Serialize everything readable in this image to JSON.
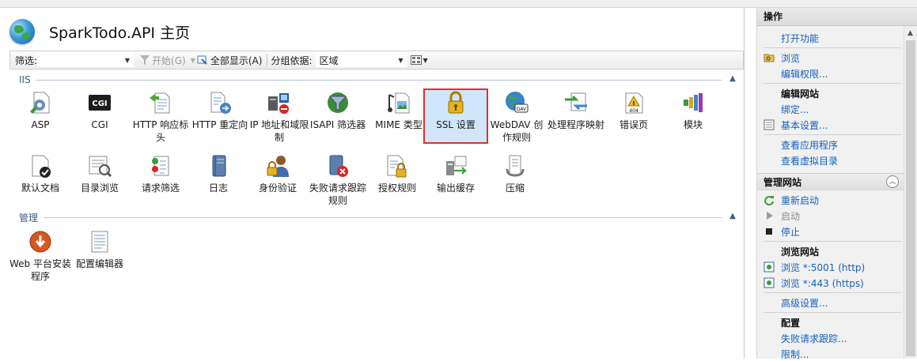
{
  "page": {
    "title": "SparkTodo.API 主页"
  },
  "toolbar": {
    "filter_label": "筛选:",
    "filter_value": "",
    "start_label": "开始(G)",
    "show_all_label": "全部显示(A)",
    "group_by_label": "分组依据:",
    "group_by_value": "区域"
  },
  "sections": {
    "iis": {
      "label": "IIS"
    },
    "management": {
      "label": "管理"
    }
  },
  "iis_items": [
    {
      "label": "ASP",
      "icon": "asp-icon"
    },
    {
      "label": "CGI",
      "icon": "cgi-icon"
    },
    {
      "label": "HTTP 响应标头",
      "icon": "http-response-headers-icon"
    },
    {
      "label": "HTTP 重定向",
      "icon": "http-redirect-icon"
    },
    {
      "label": "IP 地址和域限制",
      "icon": "ip-domain-restrictions-icon"
    },
    {
      "label": "ISAPI 筛选器",
      "icon": "isapi-filters-icon"
    },
    {
      "label": "MIME 类型",
      "icon": "mime-types-icon"
    },
    {
      "label": "SSL 设置",
      "icon": "ssl-lock-icon",
      "selected": true
    },
    {
      "label": "WebDAV 创作规则",
      "icon": "webdav-icon"
    },
    {
      "label": "处理程序映射",
      "icon": "handler-mappings-icon"
    },
    {
      "label": "错误页",
      "icon": "error-pages-icon"
    },
    {
      "label": "模块",
      "icon": "modules-icon"
    },
    {
      "label": "默认文档",
      "icon": "default-document-icon"
    },
    {
      "label": "目录浏览",
      "icon": "directory-browsing-icon"
    },
    {
      "label": "请求筛选",
      "icon": "request-filtering-icon"
    },
    {
      "label": "日志",
      "icon": "logging-icon"
    },
    {
      "label": "身份验证",
      "icon": "authentication-icon"
    },
    {
      "label": "失败请求跟踪规则",
      "icon": "failed-request-tracing-icon"
    },
    {
      "label": "授权规则",
      "icon": "authorization-rules-icon"
    },
    {
      "label": "输出缓存",
      "icon": "output-caching-icon"
    },
    {
      "label": "压缩",
      "icon": "compression-icon"
    }
  ],
  "management_items": [
    {
      "label": "Web 平台安装程序",
      "icon": "web-platform-installer-icon"
    },
    {
      "label": "配置编辑器",
      "icon": "configuration-editor-icon"
    }
  ],
  "actions": {
    "title": "操作",
    "open_feature": "打开功能",
    "browse": "浏览",
    "edit_permissions": "编辑权限...",
    "edit_site_header": "编辑网站",
    "bindings": "绑定...",
    "basic_settings": "基本设置...",
    "view_applications": "查看应用程序",
    "view_virtual_dirs": "查看虚拟目录",
    "manage_site_header": "管理网站",
    "restart": "重新启动",
    "start": "启动",
    "stop": "停止",
    "browse_site_header": "浏览网站",
    "browse_http": "浏览 *:5001 (http)",
    "browse_https": "浏览 *:443 (https)",
    "advanced_settings": "高级设置...",
    "config_header": "配置",
    "failed_request_tracing": "失败请求跟踪...",
    "limits": "限制..."
  },
  "colors": {
    "selection_border": "#e0302f",
    "selection_fill": "#cfe6fb",
    "link": "#1560bd",
    "section_text": "#3b5d8a"
  }
}
